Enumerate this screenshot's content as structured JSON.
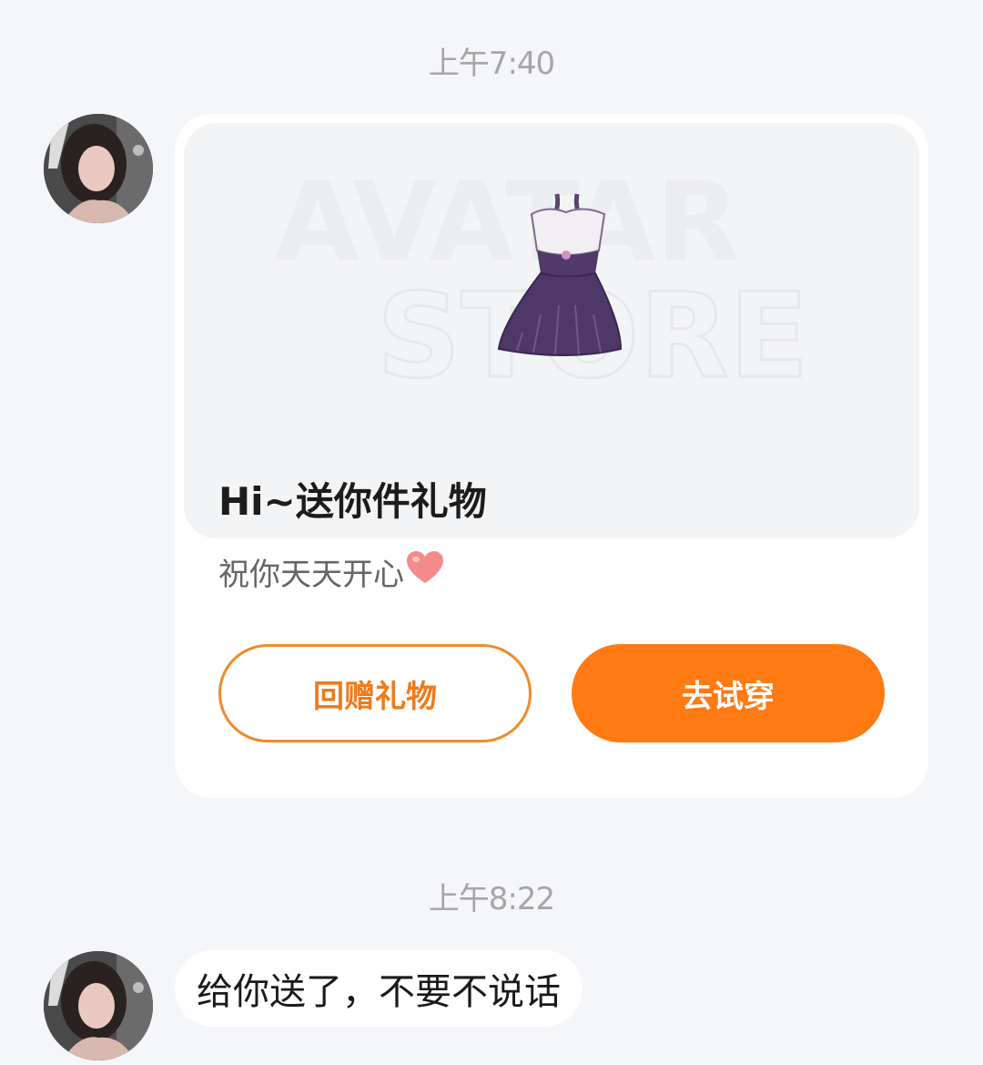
{
  "messages": {
    "first_time": "上午7:40",
    "gift_card": {
      "title": "Hi~送你件礼物",
      "subtitle": "祝你天天开心",
      "return_gift_label": "回赠礼物",
      "try_on_label": "去试穿",
      "watermark_line1": "AVATAR",
      "watermark_line2": "STORE",
      "item_icon": "purple-dress-icon"
    },
    "second_time": "上午8:22",
    "text_message": "给你送了，不要不说话"
  },
  "colors": {
    "background": "#f4f6f9",
    "accent_orange": "#ff7a12",
    "outline_orange": "#f08a2c",
    "timestamp_gray": "#a6a6a6"
  }
}
